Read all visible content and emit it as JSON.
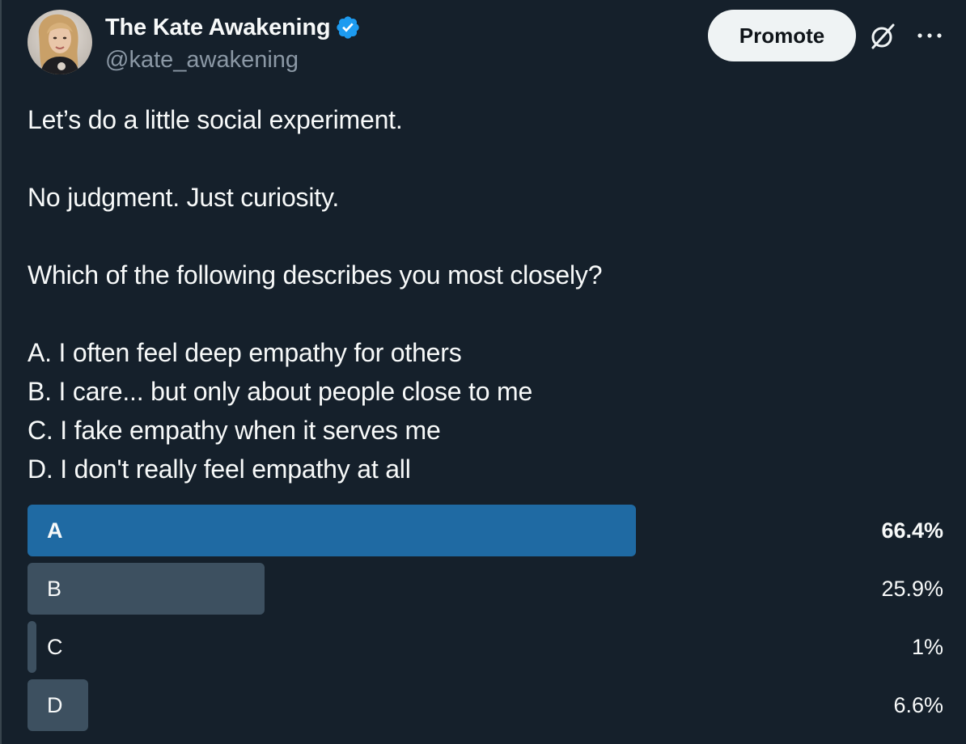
{
  "author": {
    "display_name": "The Kate Awakening",
    "handle": "@kate_awakening",
    "verified": true,
    "verified_color": "#1d9bf0"
  },
  "actions": {
    "promote_label": "Promote",
    "grok_icon": "grok-icon",
    "more_icon": "more-icon"
  },
  "tweet": {
    "lines": [
      "Let’s do a little social experiment.",
      "",
      "No judgment. Just curiosity.",
      "",
      "Which of the following describes you most closely?",
      "",
      "A. I often feel deep empathy for others",
      "B. I care... but only about people close to me",
      "C. I fake empathy when it serves me",
      "D. I don't really feel empathy at all"
    ]
  },
  "poll": {
    "winner_color": "#1f6aa3",
    "bar_color": "#3d5060",
    "options": [
      {
        "label": "A",
        "percent_text": "66.4%",
        "percent": 66.4,
        "winner": true
      },
      {
        "label": "B",
        "percent_text": "25.9%",
        "percent": 25.9,
        "winner": false
      },
      {
        "label": "C",
        "percent_text": "1%",
        "percent": 1,
        "winner": false
      },
      {
        "label": "D",
        "percent_text": "6.6%",
        "percent": 6.6,
        "winner": false
      }
    ]
  }
}
